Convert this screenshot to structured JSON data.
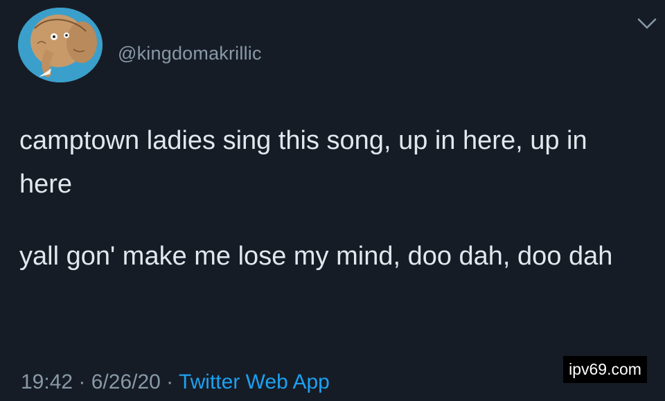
{
  "tweet": {
    "handle": "@kingdomakrillic",
    "paragraphs": [
      "camptown ladies sing this song, up in here, up in here",
      "yall gon' make me lose my mind, doo dah, doo dah"
    ],
    "time": "19:42",
    "separator": " · ",
    "date": "6/26/20",
    "source": "Twitter Web App"
  },
  "icons": {
    "avatar": "elephant-illustration-avatar",
    "menu": "chevron-down-icon"
  },
  "colors": {
    "background": "#161c26",
    "text": "#e1e8ed",
    "muted": "#8899a6",
    "link": "#1da1f2"
  },
  "watermark": "ipv69.com"
}
